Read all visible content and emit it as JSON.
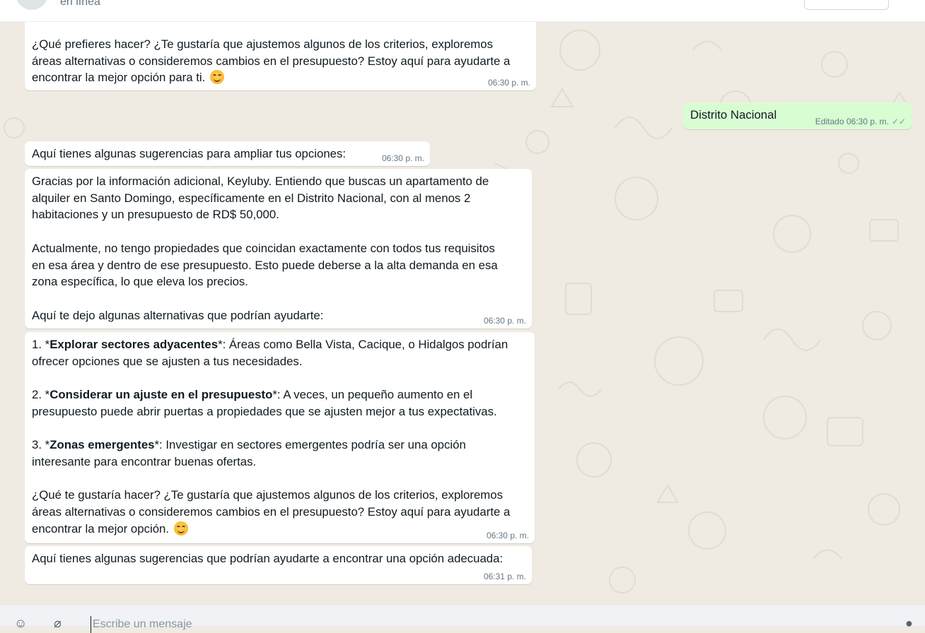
{
  "header": {
    "status": "en línea"
  },
  "messages": [
    {
      "lines": [
        "¿Qué prefieres hacer? ¿Te gustaría que ajustemos algunos de los criterios, exploremos",
        "áreas alternativas o consideremos cambios en el presupuesto? Estoy aquí para ayudarte a",
        "encontrar la mejor opción para ti."
      ],
      "time": "06:30 p. m."
    },
    {
      "text": "Distrito Nacional",
      "edited_label": "Editado",
      "time": "06:30 p. m.",
      "ticks": "✓✓"
    },
    {
      "text": "Aquí tienes algunas sugerencias para ampliar tus opciones:",
      "time": "06:30 p. m."
    },
    {
      "p1": [
        "Gracias por la información adicional, Keyluby. Entiendo que buscas un apartamento de",
        "alquiler en Santo Domingo, específicamente en el Distrito Nacional, con al menos 2",
        "habitaciones y un presupuesto de RD$ 50,000."
      ],
      "p2": [
        "Actualmente, no tengo propiedades que coincidan exactamente con todos tus requisitos",
        "en esa área y dentro de ese presupuesto. Esto puede deberse a la alta demanda en esa",
        "zona específica, lo que eleva los precios."
      ],
      "p3": "Aquí te dejo algunas alternativas que podrían ayudarte:",
      "time": "06:30 p. m."
    },
    {
      "items": [
        {
          "num": "1. *",
          "bold": "Explorar sectores adyacentes",
          "rest1": "*: Áreas como Bella Vista, Cacique, o Hidalgos podrían",
          "rest2": "ofrecer opciones que se ajusten a tus necesidades."
        },
        {
          "num": "2. *",
          "bold": "Considerar un ajuste en el presupuesto",
          "rest1": "*: A veces, un pequeño aumento en el",
          "rest2": "presupuesto puede abrir puertas a propiedades que se ajusten mejor a tus expectativas."
        },
        {
          "num": "3. *",
          "bold": "Zonas emergentes",
          "rest1": "*: Investigar en sectores emergentes podría ser una opción",
          "rest2": "interesante para encontrar buenas ofertas."
        }
      ],
      "closing": [
        "¿Qué te gustaría hacer? ¿Te gustaría que ajustemos algunos de los criterios, exploremos",
        "áreas alternativas o consideremos cambios en el presupuesto? Estoy aquí para ayudarte a",
        "encontrar la mejor opción."
      ],
      "time": "06:30 p. m."
    },
    {
      "text": "Aquí tienes algunas sugerencias que podrían ayudarte a encontrar una opción adecuada:",
      "time": "06:31 p. m."
    }
  ],
  "composer": {
    "placeholder": "Escribe un mensaje"
  },
  "colors": {
    "outgoing_bubble": "#d9fdd3",
    "incoming_bubble": "#ffffff",
    "chat_background": "#efeae2",
    "meta_text": "#667781"
  }
}
